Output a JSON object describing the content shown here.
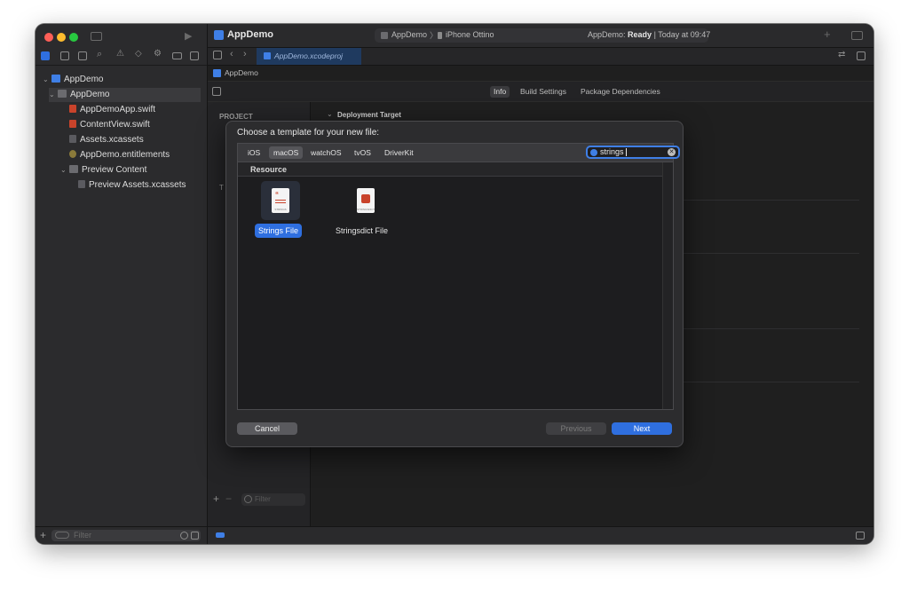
{
  "sidebar": {
    "filter_placeholder": "Filter",
    "tree": [
      {
        "label": "AppDemo",
        "icon": "xcode-project-icon"
      },
      {
        "label": "AppDemo",
        "icon": "folder-icon"
      },
      {
        "label": "AppDemoApp.swift",
        "icon": "swift-file-icon"
      },
      {
        "label": "ContentView.swift",
        "icon": "swift-file-icon"
      },
      {
        "label": "Assets.xcassets",
        "icon": "asset-catalog-icon"
      },
      {
        "label": "AppDemo.entitlements",
        "icon": "entitlements-icon"
      },
      {
        "label": "Preview Content",
        "icon": "folder-icon"
      },
      {
        "label": "Preview Assets.xcassets",
        "icon": "asset-catalog-icon"
      }
    ]
  },
  "toolbar": {
    "app_name": "AppDemo",
    "scheme": "AppDemo",
    "device": "iPhone Ottino",
    "status_prefix": "AppDemo:",
    "status_state": "Ready",
    "status_time": "| Today at 09:47"
  },
  "tab": {
    "file": "AppDemo.xcodeproj"
  },
  "jumpbar": {
    "root": "AppDemo"
  },
  "editor": {
    "tabs": [
      "Info",
      "Build Settings",
      "Package Dependencies"
    ],
    "selected_tab": "Info",
    "project_header": "PROJECT",
    "targets_header_partial": "T",
    "section": "Deployment Target",
    "filter_placeholder": "Filter"
  },
  "dialog": {
    "title": "Choose a template for your new file:",
    "platforms": [
      "iOS",
      "macOS",
      "watchOS",
      "tvOS",
      "DriverKit"
    ],
    "selected_platform": "macOS",
    "search_value": "strings",
    "section": "Resource",
    "templates": [
      {
        "name": "Strings File",
        "icon": "strings-file-icon",
        "icon_caption": "STRINGS",
        "selected": true
      },
      {
        "name": "Stringsdict File",
        "icon": "stringsdict-file-icon",
        "icon_caption": "STRINGSDICT",
        "selected": false
      }
    ],
    "cancel": "Cancel",
    "previous": "Previous",
    "next": "Next"
  },
  "colors": {
    "accent": "#2f6fdf",
    "search_ring": "#3f7fe6",
    "strings_icon": "#c9432b"
  }
}
